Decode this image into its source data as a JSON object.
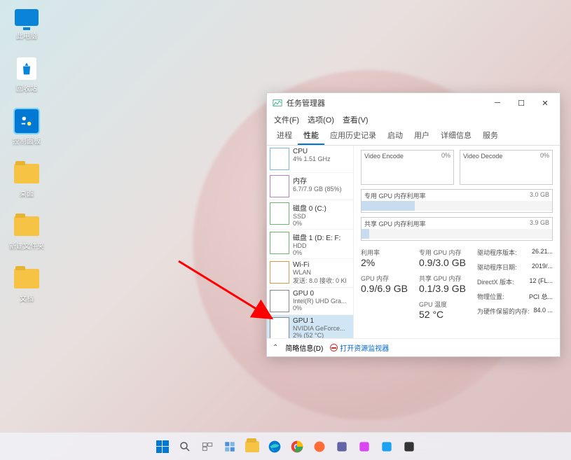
{
  "desktop": {
    "icons": [
      {
        "name": "this-pc",
        "label": "此电脑",
        "type": "monitor"
      },
      {
        "name": "recycle-bin",
        "label": "回收站",
        "type": "bin"
      },
      {
        "name": "control-panel",
        "label": "控制面板",
        "type": "cpanel"
      },
      {
        "name": "folder-1",
        "label": "桌面",
        "type": "folder"
      },
      {
        "name": "folder-2",
        "label": "新建文件夹",
        "type": "folder"
      },
      {
        "name": "folder-3",
        "label": "文档",
        "type": "folder"
      }
    ]
  },
  "taskmgr": {
    "title": "任务管理器",
    "menu": {
      "file": "文件(F)",
      "options": "选项(O)",
      "view": "查看(V)"
    },
    "tabs": [
      "进程",
      "性能",
      "应用历史记录",
      "启动",
      "用户",
      "详细信息",
      "服务"
    ],
    "active_tab_index": 1,
    "sidebar": [
      {
        "name": "CPU",
        "sub": "4% 1.51 GHz",
        "stat": "",
        "cls": "cpu"
      },
      {
        "name": "内存",
        "sub": "6.7/7.9 GB (85%)",
        "stat": "",
        "cls": "mem"
      },
      {
        "name": "磁盘 0 (C:)",
        "sub": "SSD",
        "stat": "0%",
        "cls": "disk0"
      },
      {
        "name": "磁盘 1 (D: E: F:",
        "sub": "HDD",
        "stat": "0%",
        "cls": "disk1"
      },
      {
        "name": "Wi-Fi",
        "sub": "WLAN",
        "stat": "发送: 8.0 接收: 0 Kl",
        "cls": "wifi"
      },
      {
        "name": "GPU 0",
        "sub": "Intel(R) UHD Gra...",
        "stat": "0%",
        "cls": "gpu0"
      },
      {
        "name": "GPU 1",
        "sub": "NVIDIA GeForce...",
        "stat": "2% (52 °C)",
        "cls": "gpu1"
      }
    ],
    "selected_index": 6,
    "details": {
      "video_encode": {
        "label": "Video Encode",
        "pct": "0%"
      },
      "video_decode": {
        "label": "Video Decode",
        "pct": "0%"
      },
      "dedicated_mem": {
        "label": "专用 GPU 内存利用率",
        "cap": "3.0 GB"
      },
      "shared_mem": {
        "label": "共享 GPU 内存利用率",
        "cap": "3.9 GB"
      },
      "stats": {
        "util_label": "利用率",
        "util_value": "2%",
        "gpu_mem_label": "GPU 内存",
        "gpu_mem_value": "0.9/6.9 GB",
        "ded_mem_label": "专用 GPU 内存",
        "ded_mem_value": "0.9/3.0 GB",
        "shared_mem_label": "共享 GPU 内存",
        "shared_mem_value": "0.1/3.9 GB",
        "temp_label": "GPU 温度",
        "temp_value": "52 °C"
      },
      "info": {
        "driver_version_label": "驱动程序版本:",
        "driver_version_value": "26.21...",
        "driver_date_label": "驱动程序日期:",
        "driver_date_value": "2019/...",
        "directx_label": "DirectX 版本:",
        "directx_value": "12 (FL...",
        "location_label": "物理位置:",
        "location_value": "PCI 总...",
        "reserved_label": "为硬件保留的内存:",
        "reserved_value": "84.0 ..."
      }
    },
    "footer": {
      "brief": "简略信息(D)",
      "resmon": "打开资源监视器"
    }
  },
  "taskbar": {
    "icons": [
      "start",
      "search",
      "taskview",
      "widgets",
      "explorer",
      "edge",
      "chrome",
      "firefox",
      "teams",
      "store",
      "app1",
      "app2"
    ]
  }
}
